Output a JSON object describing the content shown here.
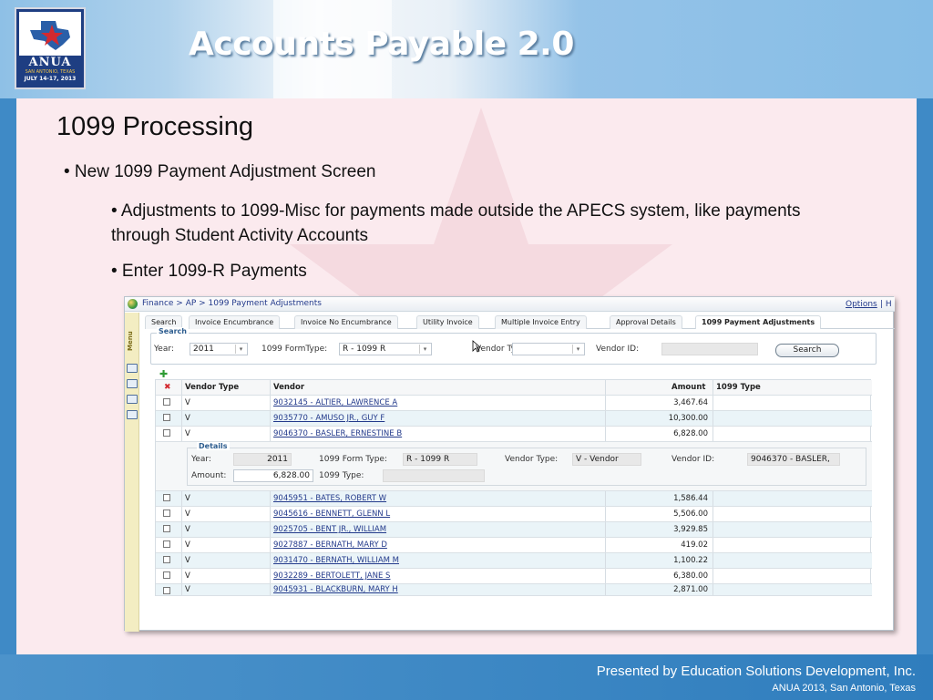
{
  "header": {
    "title": "Accounts Payable 2.0",
    "logo": {
      "name": "ANUA",
      "location": "SAN ANTONIO, TEXAS",
      "dates": "JULY 14-17, 2013"
    }
  },
  "slide": {
    "heading": "1099 Processing",
    "bullet1": "• New 1099 Payment Adjustment Screen",
    "bullet2": "•  Adjustments to 1099-Misc for payments made outside the APECS system, like payments through Student Activity Accounts",
    "bullet3": "• Enter 1099-R Payments"
  },
  "app": {
    "breadcrumb": "Finance > AP > 1099 Payment Adjustments",
    "options_link": "Options",
    "options_extra": "| H",
    "menu_label": "Menu",
    "tabs": [
      "Search",
      "Invoice Encumbrance",
      "Invoice No Encumbrance",
      "Utility Invoice",
      "Multiple Invoice Entry",
      "Approval Details",
      "1099 Payment Adjustments"
    ],
    "search": {
      "legend": "Search",
      "year_label": "Year:",
      "year_value": "2011",
      "formtype_label": "1099 FormType:",
      "formtype_value": "R - 1099 R",
      "vendortype_label": "Vendor Type:",
      "vendortype_value": "",
      "vendorid_label": "Vendor ID:",
      "vendorid_value": "",
      "search_button": "Search"
    },
    "grid": {
      "columns": [
        "Vendor Type",
        "Vendor",
        "Amount",
        "1099 Type"
      ],
      "rows_top": [
        {
          "type": "V",
          "vendor": "9032145 - ALTIER, LAWRENCE A",
          "amount": "3,467.64",
          "form": ""
        },
        {
          "type": "V",
          "vendor": "9035770 - AMUSO JR., GUY F",
          "amount": "10,300.00",
          "form": ""
        },
        {
          "type": "V",
          "vendor": "9046370 - BASLER, ERNESTINE B",
          "amount": "6,828.00",
          "form": ""
        }
      ],
      "details": {
        "legend": "Details",
        "year_label": "Year:",
        "year_value": "2011",
        "formtype_label": "1099 Form Type:",
        "formtype_value": "R - 1099 R",
        "vendortype_label": "Vendor Type:",
        "vendortype_value": "V - Vendor",
        "vendorid_label": "Vendor ID:",
        "vendorid_value": "9046370 - BASLER,",
        "amount_label": "Amount:",
        "amount_value": "6,828.00",
        "type1099_label": "1099 Type:",
        "type1099_value": ""
      },
      "rows_bottom": [
        {
          "type": "V",
          "vendor": "9045951 - BATES, ROBERT W",
          "amount": "1,586.44",
          "form": ""
        },
        {
          "type": "V",
          "vendor": "9045616 - BENNETT, GLENN L",
          "amount": "5,506.00",
          "form": ""
        },
        {
          "type": "V",
          "vendor": "9025705 - BENT JR., WILLIAM",
          "amount": "3,929.85",
          "form": ""
        },
        {
          "type": "V",
          "vendor": "9027887 - BERNATH, MARY D",
          "amount": "419.02",
          "form": ""
        },
        {
          "type": "V",
          "vendor": "9031470 - BERNATH, WILLIAM M",
          "amount": "1,100.22",
          "form": ""
        },
        {
          "type": "V",
          "vendor": "9032289 - BERTOLETT, JANE S",
          "amount": "6,380.00",
          "form": ""
        },
        {
          "type": "V",
          "vendor": "9045931 - BLACKBURN, MARY H",
          "amount": "2,871.00",
          "form": ""
        }
      ]
    }
  },
  "footer": {
    "presenter": "Presented by Education Solutions Development, Inc.",
    "event": "ANUA 2013, San Antonio, Texas"
  }
}
